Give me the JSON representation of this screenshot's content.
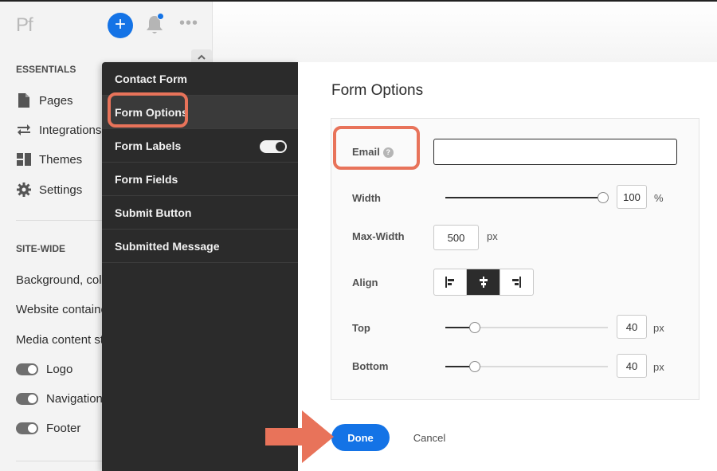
{
  "app": {
    "logo": "Pf"
  },
  "header": {
    "add_label": "+",
    "more_label": "•••"
  },
  "sidebar": {
    "essentials_heading": "ESSENTIALS",
    "items": [
      {
        "label": "Pages",
        "icon": "page-icon"
      },
      {
        "label": "Integrations",
        "icon": "integrations-icon"
      },
      {
        "label": "Themes",
        "icon": "themes-icon"
      },
      {
        "label": "Settings",
        "icon": "gear-icon"
      }
    ],
    "sitewide_heading": "SITE-WIDE",
    "sitewide_items": [
      {
        "label": "Background, colo"
      },
      {
        "label": "Website containe"
      },
      {
        "label": "Media content sty"
      }
    ],
    "toggles": [
      {
        "label": "Logo",
        "on": true
      },
      {
        "label": "Navigation",
        "on": true
      },
      {
        "label": "Footer",
        "on": true
      }
    ]
  },
  "menu": {
    "items": [
      {
        "label": "Contact Form"
      },
      {
        "label": "Form Options"
      },
      {
        "label": "Form Labels"
      },
      {
        "label": "Form Fields"
      },
      {
        "label": "Submit Button"
      },
      {
        "label": "Submitted Message"
      }
    ],
    "form_labels_toggle_on": true
  },
  "panel": {
    "title": "Form Options",
    "email": {
      "label": "Email",
      "help": "?",
      "value": ""
    },
    "width": {
      "label": "Width",
      "value": "100",
      "unit": "%",
      "level": 1.0
    },
    "max_width": {
      "label": "Max-Width",
      "value": "500",
      "unit": "px"
    },
    "align": {
      "label": "Align",
      "options": [
        "left",
        "center",
        "right"
      ],
      "selected": "center"
    },
    "top": {
      "label": "Top",
      "value": "40",
      "unit": "px",
      "level": 0.18
    },
    "bottom": {
      "label": "Bottom",
      "value": "40",
      "unit": "px",
      "level": 0.18
    }
  },
  "actions": {
    "done_label": "Done",
    "cancel_label": "Cancel"
  },
  "colors": {
    "accent": "#1473e6",
    "annotation": "#e8735a",
    "dark_panel": "#2b2b2b"
  }
}
